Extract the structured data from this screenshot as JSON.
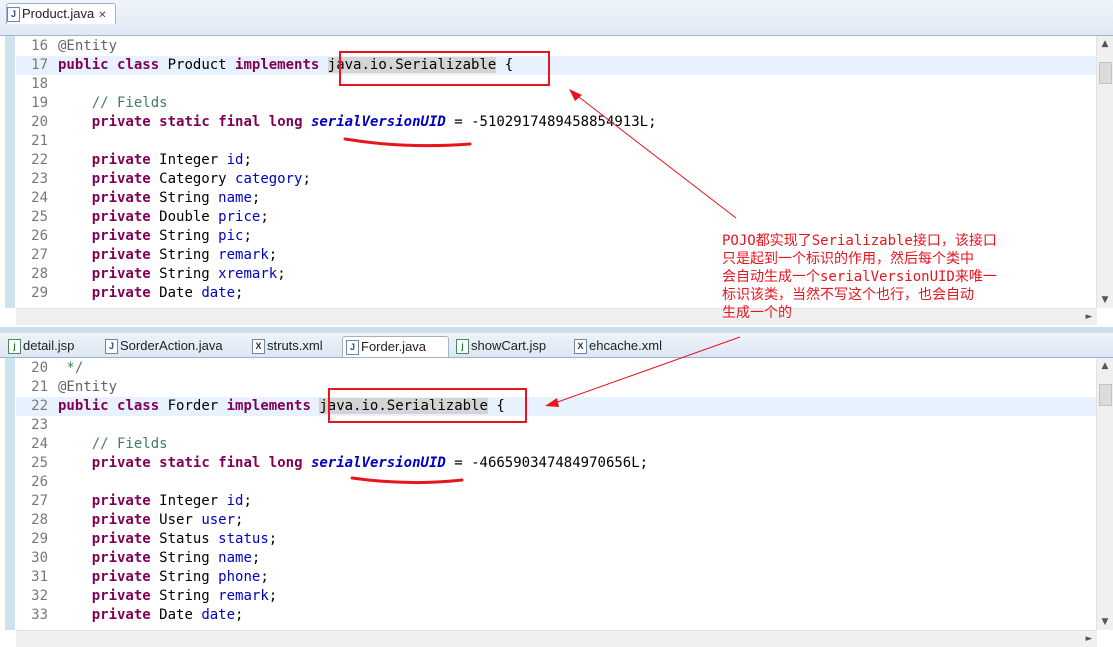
{
  "top_pane": {
    "tabs": [
      {
        "label": "Product.java",
        "icon": "java-file-icon",
        "active": true
      }
    ],
    "lines": [
      {
        "n": "16",
        "tokens": [
          {
            "t": "@Entity",
            "c": "ann"
          }
        ]
      },
      {
        "n": "17",
        "current": true,
        "tokens": [
          {
            "t": "public",
            "c": "kw"
          },
          {
            "t": " "
          },
          {
            "t": "class",
            "c": "kw"
          },
          {
            "t": " Product "
          },
          {
            "t": "implements",
            "c": "kw"
          },
          {
            "t": " "
          },
          {
            "t": "java.io.Serializable",
            "c": "hl"
          },
          {
            "t": " {"
          }
        ]
      },
      {
        "n": "18",
        "tokens": []
      },
      {
        "n": "19",
        "tokens": [
          {
            "t": "    "
          },
          {
            "t": "// Fields",
            "c": "cmt"
          }
        ]
      },
      {
        "n": "20",
        "tokens": [
          {
            "t": "    "
          },
          {
            "t": "private",
            "c": "kw"
          },
          {
            "t": " "
          },
          {
            "t": "static",
            "c": "kw"
          },
          {
            "t": " "
          },
          {
            "t": "final",
            "c": "kw"
          },
          {
            "t": " "
          },
          {
            "t": "long",
            "c": "kw"
          },
          {
            "t": " "
          },
          {
            "t": "serialVersionUID",
            "c": "sfld"
          },
          {
            "t": " = -5102917489458854913L;"
          }
        ]
      },
      {
        "n": "21",
        "tokens": []
      },
      {
        "n": "22",
        "tokens": [
          {
            "t": "    "
          },
          {
            "t": "private",
            "c": "kw"
          },
          {
            "t": " Integer "
          },
          {
            "t": "id",
            "c": "fld"
          },
          {
            "t": ";"
          }
        ]
      },
      {
        "n": "23",
        "tokens": [
          {
            "t": "    "
          },
          {
            "t": "private",
            "c": "kw"
          },
          {
            "t": " Category "
          },
          {
            "t": "category",
            "c": "fld"
          },
          {
            "t": ";"
          }
        ]
      },
      {
        "n": "24",
        "tokens": [
          {
            "t": "    "
          },
          {
            "t": "private",
            "c": "kw"
          },
          {
            "t": " String "
          },
          {
            "t": "name",
            "c": "fld"
          },
          {
            "t": ";"
          }
        ]
      },
      {
        "n": "25",
        "tokens": [
          {
            "t": "    "
          },
          {
            "t": "private",
            "c": "kw"
          },
          {
            "t": " Double "
          },
          {
            "t": "price",
            "c": "fld"
          },
          {
            "t": ";"
          }
        ]
      },
      {
        "n": "26",
        "tokens": [
          {
            "t": "    "
          },
          {
            "t": "private",
            "c": "kw"
          },
          {
            "t": " String "
          },
          {
            "t": "pic",
            "c": "fld"
          },
          {
            "t": ";"
          }
        ]
      },
      {
        "n": "27",
        "tokens": [
          {
            "t": "    "
          },
          {
            "t": "private",
            "c": "kw"
          },
          {
            "t": " String "
          },
          {
            "t": "remark",
            "c": "fld"
          },
          {
            "t": ";"
          }
        ]
      },
      {
        "n": "28",
        "tokens": [
          {
            "t": "    "
          },
          {
            "t": "private",
            "c": "kw"
          },
          {
            "t": " String "
          },
          {
            "t": "xremark",
            "c": "fld"
          },
          {
            "t": ";"
          }
        ]
      },
      {
        "n": "29",
        "tokens": [
          {
            "t": "    "
          },
          {
            "t": "private",
            "c": "kw"
          },
          {
            "t": " Date "
          },
          {
            "t": "date",
            "c": "fld"
          },
          {
            "t": ";"
          }
        ]
      }
    ]
  },
  "bottom_pane": {
    "tabs": [
      {
        "label": "detail.jsp",
        "icon": "jsp-file-icon",
        "active": false
      },
      {
        "label": "SorderAction.java",
        "icon": "java-file-icon",
        "active": false
      },
      {
        "label": "struts.xml",
        "icon": "xml-file-icon",
        "active": false
      },
      {
        "label": "Forder.java",
        "icon": "java-file-icon",
        "active": true
      },
      {
        "label": "showCart.jsp",
        "icon": "jsp-file-icon",
        "active": false
      },
      {
        "label": "ehcache.xml",
        "icon": "xml-file-icon",
        "active": false
      }
    ],
    "lines": [
      {
        "n": "20",
        "tokens": [
          {
            "t": " */",
            "c": "cmt"
          }
        ]
      },
      {
        "n": "21",
        "tokens": [
          {
            "t": "@Entity",
            "c": "ann"
          }
        ]
      },
      {
        "n": "22",
        "current": true,
        "tokens": [
          {
            "t": "public",
            "c": "kw"
          },
          {
            "t": " "
          },
          {
            "t": "class",
            "c": "kw"
          },
          {
            "t": " Forder "
          },
          {
            "t": "implements",
            "c": "kw"
          },
          {
            "t": " "
          },
          {
            "t": "java.io.Serializable",
            "c": "hl"
          },
          {
            "t": " {"
          }
        ]
      },
      {
        "n": "23",
        "tokens": []
      },
      {
        "n": "24",
        "tokens": [
          {
            "t": "    "
          },
          {
            "t": "// Fields",
            "c": "cmt"
          }
        ]
      },
      {
        "n": "25",
        "tokens": [
          {
            "t": "    "
          },
          {
            "t": "private",
            "c": "kw"
          },
          {
            "t": " "
          },
          {
            "t": "static",
            "c": "kw"
          },
          {
            "t": " "
          },
          {
            "t": "final",
            "c": "kw"
          },
          {
            "t": " "
          },
          {
            "t": "long",
            "c": "kw"
          },
          {
            "t": " "
          },
          {
            "t": "serialVersionUID",
            "c": "sfld"
          },
          {
            "t": " = -466590347484970656L;"
          }
        ]
      },
      {
        "n": "26",
        "tokens": []
      },
      {
        "n": "27",
        "tokens": [
          {
            "t": "    "
          },
          {
            "t": "private",
            "c": "kw"
          },
          {
            "t": " Integer "
          },
          {
            "t": "id",
            "c": "fld"
          },
          {
            "t": ";"
          }
        ]
      },
      {
        "n": "28",
        "tokens": [
          {
            "t": "    "
          },
          {
            "t": "private",
            "c": "kw"
          },
          {
            "t": " User "
          },
          {
            "t": "user",
            "c": "fld"
          },
          {
            "t": ";"
          }
        ]
      },
      {
        "n": "29",
        "tokens": [
          {
            "t": "    "
          },
          {
            "t": "private",
            "c": "kw"
          },
          {
            "t": " Status "
          },
          {
            "t": "status",
            "c": "fld"
          },
          {
            "t": ";"
          }
        ]
      },
      {
        "n": "30",
        "tokens": [
          {
            "t": "    "
          },
          {
            "t": "private",
            "c": "kw"
          },
          {
            "t": " String "
          },
          {
            "t": "name",
            "c": "fld"
          },
          {
            "t": ";"
          }
        ]
      },
      {
        "n": "31",
        "tokens": [
          {
            "t": "    "
          },
          {
            "t": "private",
            "c": "kw"
          },
          {
            "t": " String "
          },
          {
            "t": "phone",
            "c": "fld"
          },
          {
            "t": ";"
          }
        ]
      },
      {
        "n": "32",
        "tokens": [
          {
            "t": "    "
          },
          {
            "t": "private",
            "c": "kw"
          },
          {
            "t": " String "
          },
          {
            "t": "remark",
            "c": "fld"
          },
          {
            "t": ";"
          }
        ]
      },
      {
        "n": "33",
        "tokens": [
          {
            "t": "    "
          },
          {
            "t": "private",
            "c": "kw"
          },
          {
            "t": " Date "
          },
          {
            "t": "date",
            "c": "fld"
          },
          {
            "t": ";"
          }
        ]
      }
    ]
  },
  "annotation": {
    "note_lines": [
      "POJO都实现了Serializable接口，该接口",
      "只是起到一个标识的作用，然后每个类中",
      "会自动生成一个serialVersionUID来唯一",
      "标识该类，当然不写这个也行，也会自动",
      "生成一个的"
    ],
    "color": "#e8141e"
  },
  "colors": {
    "keyword": "#7f0055",
    "field": "#0000c0",
    "comment": "#3f7f5f",
    "current_line": "#e8f2fe",
    "annotation_red": "#e8141e"
  }
}
